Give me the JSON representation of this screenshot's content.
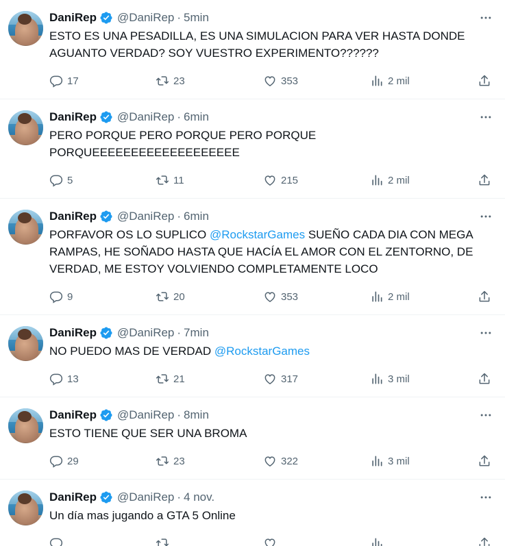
{
  "colors": {
    "accent": "#1d9bf0",
    "text": "#0f1419",
    "muted": "#536471",
    "divider": "#eff3f4"
  },
  "icons": {
    "verified": "verified-badge-icon",
    "more": "more-icon",
    "reply": "reply-icon",
    "retweet": "retweet-icon",
    "like": "like-icon",
    "views": "views-icon",
    "share": "share-icon"
  },
  "tweets": [
    {
      "name": "DaniRep",
      "handle": "@DaniRep",
      "separator": "·",
      "time": "5min",
      "segments": [
        {
          "text": "ESTO ES UNA PESADILLA, ES UNA SIMULACION PARA VER HASTA DONDE AGUANTO VERDAD? SOY VUESTRO EXPERIMENTO??????",
          "mention": false
        }
      ],
      "replies": "17",
      "retweets": "23",
      "likes": "353",
      "views": "2 mil"
    },
    {
      "name": "DaniRep",
      "handle": "@DaniRep",
      "separator": "·",
      "time": "6min",
      "segments": [
        {
          "text": "PERO PORQUE PERO PORQUE PERO PORQUE PORQUEEEEEEEEEEEEEEEEEEE",
          "mention": false
        }
      ],
      "replies": "5",
      "retweets": "11",
      "likes": "215",
      "views": "2 mil"
    },
    {
      "name": "DaniRep",
      "handle": "@DaniRep",
      "separator": "·",
      "time": "6min",
      "segments": [
        {
          "text": "PORFAVOR OS LO SUPLICO ",
          "mention": false
        },
        {
          "text": "@RockstarGames",
          "mention": true
        },
        {
          "text": " SUEÑO CADA DIA CON MEGA RAMPAS, HE SOÑADO HASTA QUE HACÍA EL AMOR CON EL ZENTORNO, DE VERDAD, ME ESTOY VOLVIENDO COMPLETAMENTE LOCO",
          "mention": false
        }
      ],
      "replies": "9",
      "retweets": "20",
      "likes": "353",
      "views": "2 mil"
    },
    {
      "name": "DaniRep",
      "handle": "@DaniRep",
      "separator": "·",
      "time": "7min",
      "segments": [
        {
          "text": "NO PUEDO MAS DE VERDAD ",
          "mention": false
        },
        {
          "text": "@RockstarGames",
          "mention": true
        }
      ],
      "replies": "13",
      "retweets": "21",
      "likes": "317",
      "views": "3 mil"
    },
    {
      "name": "DaniRep",
      "handle": "@DaniRep",
      "separator": "·",
      "time": "8min",
      "segments": [
        {
          "text": "ESTO TIENE QUE SER UNA BROMA",
          "mention": false
        }
      ],
      "replies": "29",
      "retweets": "23",
      "likes": "322",
      "views": "3 mil"
    },
    {
      "name": "DaniRep",
      "handle": "@DaniRep",
      "separator": "·",
      "time": "4 nov.",
      "segments": [
        {
          "text": "Un día mas jugando a GTA 5 Online",
          "mention": false
        }
      ],
      "replies": "",
      "retweets": "",
      "likes": "",
      "views": ""
    }
  ]
}
